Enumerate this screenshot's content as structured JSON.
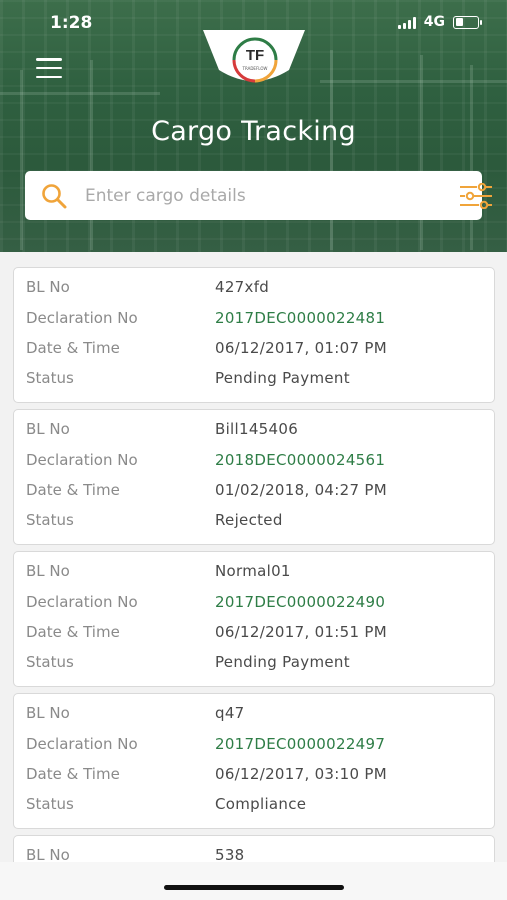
{
  "status_bar": {
    "time": "1:28",
    "network": "4G"
  },
  "header": {
    "title": "Cargo Tracking",
    "logo_text": "TF",
    "logo_subtext": "TRADEFLOW"
  },
  "search": {
    "placeholder": "Enter cargo details",
    "icon": "search-icon",
    "filter_icon": "sliders-filter-icon"
  },
  "colors": {
    "accent": "#f0a43a",
    "declaration_green": "#2e7d46",
    "header_green": "#2f6040"
  },
  "labels": {
    "bl_no": "BL No",
    "declaration_no": "Declaration No",
    "date_time": "Date & Time",
    "status": "Status"
  },
  "cargo_list": [
    {
      "bl_no": "427xfd",
      "declaration_no": "2017DEC0000022481",
      "date_time": "06/12/2017, 01:07 PM",
      "status": "Pending Payment"
    },
    {
      "bl_no": "Bill145406",
      "declaration_no": "2018DEC0000024561",
      "date_time": "01/02/2018, 04:27 PM",
      "status": "Rejected"
    },
    {
      "bl_no": "Normal01",
      "declaration_no": "2017DEC0000022490",
      "date_time": "06/12/2017, 01:51 PM",
      "status": "Pending Payment"
    },
    {
      "bl_no": "q47",
      "declaration_no": "2017DEC0000022497",
      "date_time": "06/12/2017, 03:10 PM",
      "status": "Compliance"
    },
    {
      "bl_no": "538"
    }
  ]
}
